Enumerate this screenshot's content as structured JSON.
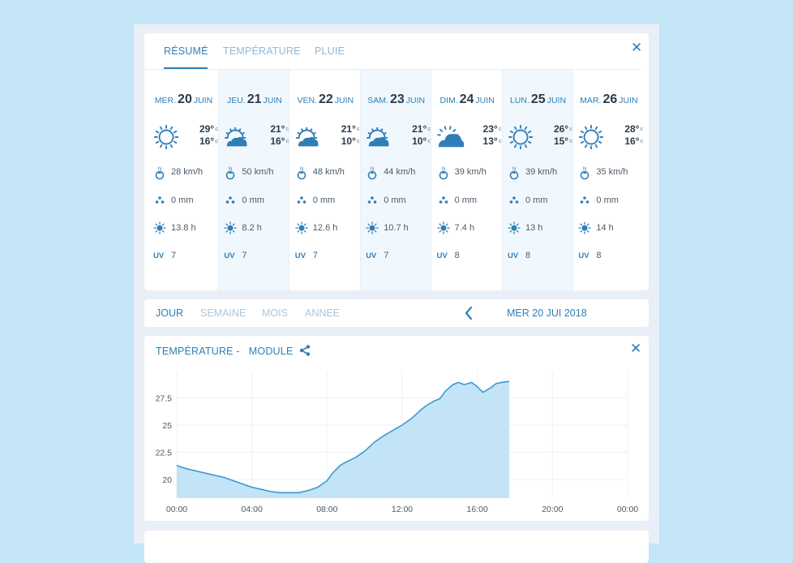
{
  "forecast": {
    "tabs": [
      "RÉSUMÉ",
      "TEMPÉRATURE",
      "PLUIE"
    ],
    "active_tab": 0,
    "close_icon": "close-icon",
    "temp_unit": "c",
    "uv_label": "UV",
    "days": [
      {
        "weekday": "MER.",
        "day": "20",
        "month": "JUIN",
        "icon": "sun-icon",
        "max": "29°",
        "min": "16°",
        "wind": "28 km/h",
        "rain": "0 mm",
        "sun": "13.8 h",
        "uv": "7",
        "shaded": false
      },
      {
        "weekday": "JEU.",
        "day": "21",
        "month": "JUIN",
        "icon": "partly-cloudy-icon",
        "max": "21°",
        "min": "16°",
        "wind": "50 km/h",
        "rain": "0 mm",
        "sun": "8.2 h",
        "uv": "7",
        "shaded": true
      },
      {
        "weekday": "VEN.",
        "day": "22",
        "month": "JUIN",
        "icon": "partly-cloudy-icon",
        "max": "21°",
        "min": "10°",
        "wind": "48 km/h",
        "rain": "0 mm",
        "sun": "12.6 h",
        "uv": "7",
        "shaded": false
      },
      {
        "weekday": "SAM.",
        "day": "23",
        "month": "JUIN",
        "icon": "partly-cloudy-icon",
        "max": "21°",
        "min": "10°",
        "wind": "44 km/h",
        "rain": "0 mm",
        "sun": "10.7 h",
        "uv": "7",
        "shaded": true
      },
      {
        "weekday": "DIM.",
        "day": "24",
        "month": "JUIN",
        "icon": "cloudy-sun-icon",
        "max": "23°",
        "min": "13°",
        "wind": "39 km/h",
        "rain": "0 mm",
        "sun": "7.4 h",
        "uv": "8",
        "shaded": false
      },
      {
        "weekday": "LUN.",
        "day": "25",
        "month": "JUIN",
        "icon": "sun-icon",
        "max": "26°",
        "min": "15°",
        "wind": "39 km/h",
        "rain": "0 mm",
        "sun": "13 h",
        "uv": "8",
        "shaded": true
      },
      {
        "weekday": "MAR.",
        "day": "26",
        "month": "JUIN",
        "icon": "sun-icon",
        "max": "28°",
        "min": "16°",
        "wind": "35 km/h",
        "rain": "0 mm",
        "sun": "14 h",
        "uv": "8",
        "shaded": false
      }
    ]
  },
  "period_nav": {
    "tabs": [
      "JOUR",
      "SEMAINE",
      "MOIS",
      "ANNEE"
    ],
    "active_tab": 0,
    "prev_icon": "chevron-left-icon",
    "date": "MER 20 JUI 2018"
  },
  "chart": {
    "title": "TEMPÉRATURE -",
    "module": "MODULE",
    "share_icon": "share-icon",
    "close_icon": "close-icon"
  },
  "colors": {
    "accent": "#2e7fb8",
    "fill": "#c3e3f6",
    "line": "#3a9ad4",
    "background": "#c4e6f7"
  },
  "chart_data": {
    "type": "area",
    "title": "TEMPÉRATURE - MODULE",
    "xlabel": "",
    "ylabel": "",
    "x_ticks": [
      "00:00",
      "04:00",
      "08:00",
      "12:00",
      "16:00",
      "20:00",
      "00:00"
    ],
    "y_ticks": [
      20,
      22.5,
      25,
      27.5
    ],
    "xlim": [
      0,
      24
    ],
    "ylim": [
      18.3,
      29.9
    ],
    "grid": true,
    "series": [
      {
        "x": [
          0,
          0.5,
          1,
          1.5,
          2,
          2.5,
          3,
          3.5,
          4,
          4.5,
          5,
          5.5,
          6,
          6.5,
          7,
          7.5,
          8,
          8.3,
          8.7,
          9,
          9.5,
          10,
          10.5,
          11,
          11.5,
          12,
          12.5,
          13,
          13.3,
          13.7,
          14,
          14.3,
          14.7,
          15,
          15.3,
          15.7,
          16,
          16.3,
          16.7,
          17,
          17.3,
          17.7
        ],
        "y": [
          21.3,
          21.0,
          20.8,
          20.6,
          20.4,
          20.2,
          19.9,
          19.6,
          19.3,
          19.1,
          18.9,
          18.8,
          18.8,
          18.8,
          19.0,
          19.3,
          19.9,
          20.6,
          21.3,
          21.6,
          22.0,
          22.6,
          23.4,
          24.0,
          24.5,
          25.0,
          25.6,
          26.4,
          26.8,
          27.2,
          27.4,
          28.1,
          28.7,
          28.9,
          28.7,
          28.9,
          28.5,
          28.0,
          28.4,
          28.8,
          28.9,
          29.0
        ]
      }
    ]
  }
}
